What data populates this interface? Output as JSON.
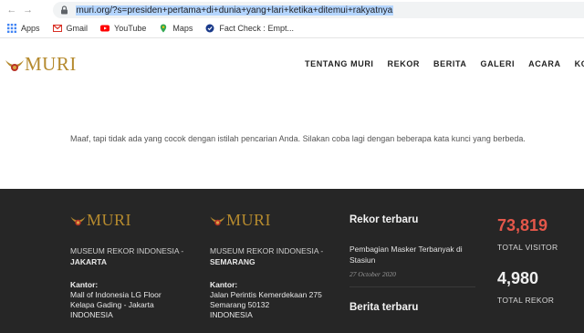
{
  "browser": {
    "url": "muri.org/?s=presiden+pertama+di+dunia+yang+lari+ketika+ditemui+rakyatnya",
    "bookmarks": [
      {
        "label": "Apps",
        "icon": "apps-grid-icon"
      },
      {
        "label": "Gmail",
        "icon": "gmail-icon"
      },
      {
        "label": "YouTube",
        "icon": "youtube-icon"
      },
      {
        "label": "Maps",
        "icon": "maps-icon"
      },
      {
        "label": "Fact Check : Empt...",
        "icon": "fact-check-icon"
      }
    ]
  },
  "header": {
    "logo_text": "MURI",
    "nav": [
      "TENTANG MURI",
      "REKOR",
      "BERITA",
      "GALERI",
      "ACARA",
      "KONTAK"
    ]
  },
  "main": {
    "message": "Maaf, tapi tidak ada yang cocok dengan istilah pencarian Anda. Silakan coba lagi dengan beberapa kata kunci yang berbeda."
  },
  "footer": {
    "logo_text": "MURI",
    "jakarta": {
      "name_line1": "MUSEUM REKOR INDONESIA -",
      "name_line2": "JAKARTA",
      "kantor_label": "Kantor:",
      "addr1": "Mall of Indonesia LG Floor",
      "addr2": "Kelapa Gading - Jakarta",
      "addr3": "INDONESIA"
    },
    "semarang": {
      "name_line1": "MUSEUM REKOR INDONESIA -",
      "name_line2": "SEMARANG",
      "kantor_label": "Kantor:",
      "addr1": "Jalan Perintis Kemerdekaan 275",
      "addr2": "Semarang 50132",
      "addr3": "INDONESIA"
    },
    "rekor": {
      "heading": "Rekor terbaru",
      "item_title": "Pembagian Masker Terbanyak di Stasiun",
      "item_date": "27 October 2020"
    },
    "berita": {
      "heading": "Berita terbaru"
    },
    "stats": {
      "visitors": "73,819",
      "visitors_label": "TOTAL VISITOR",
      "visitors_color": "#e4574a",
      "records": "4,980",
      "records_label": "TOTAL REKOR"
    }
  }
}
